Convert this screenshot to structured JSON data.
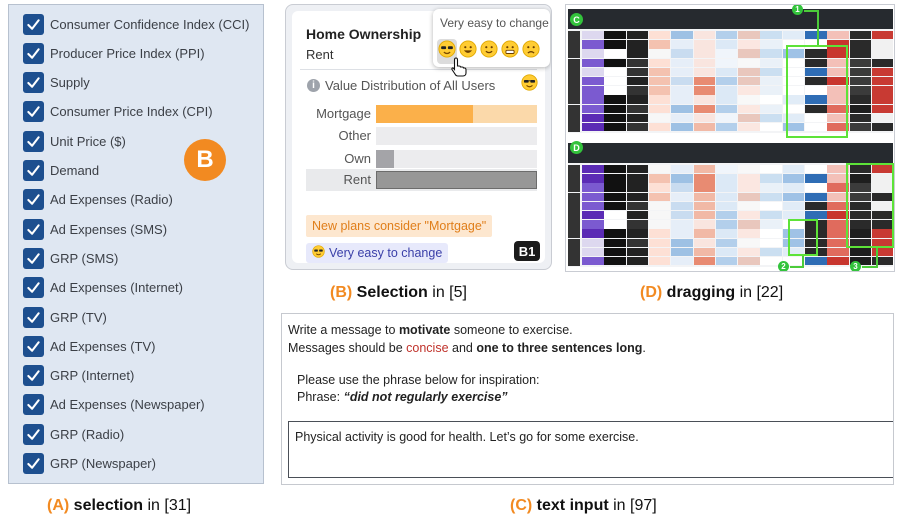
{
  "panel_a": {
    "badge": "B",
    "items": [
      {
        "label": "Consumer Confidence Index (CCI)",
        "checked": true
      },
      {
        "label": "Producer Price Index (PPI)",
        "checked": true
      },
      {
        "label": "Supply",
        "checked": true
      },
      {
        "label": "Consumer Price Index (CPI)",
        "checked": true
      },
      {
        "label": "Unit Price ($)",
        "checked": true
      },
      {
        "label": "Demand",
        "checked": true
      },
      {
        "label": "Ad Expenses (Radio)",
        "checked": true
      },
      {
        "label": "Ad Expenses (SMS)",
        "checked": true
      },
      {
        "label": "GRP (SMS)",
        "checked": true
      },
      {
        "label": "Ad Expenses (Internet)",
        "checked": true
      },
      {
        "label": "GRP (TV)",
        "checked": true
      },
      {
        "label": "Ad Expenses (TV)",
        "checked": true
      },
      {
        "label": "GRP (Internet)",
        "checked": true
      },
      {
        "label": "Ad Expenses (Newspaper)",
        "checked": true
      },
      {
        "label": "GRP (Radio)",
        "checked": true
      },
      {
        "label": "GRP (Newspaper)",
        "checked": true
      }
    ],
    "caption": {
      "tag": "(A)",
      "title": "selection",
      "ref": "in [31]"
    }
  },
  "panel_b": {
    "title": "Home Ownership",
    "value": "Rent",
    "popup_title": "Very easy to change",
    "distribution_title": "Value Distribution of All Users",
    "info_icon": "i",
    "bars": [
      {
        "label": "Mortgage",
        "share": 0.6,
        "color": "#fbb04a",
        "bg": "#fbd9aa"
      },
      {
        "label": "Other",
        "share": 0.0,
        "color": "#cfcfd3",
        "bg": "#ececee"
      },
      {
        "label": "Own",
        "share": 0.11,
        "color": "#a4a4a8",
        "bg": "#ececee"
      },
      {
        "label": "Rent",
        "share": 1.0,
        "color": "#979797",
        "bg": "#979797"
      }
    ],
    "suggestion": "New plans consider \"Mortgage\"",
    "chip_label": "Very easy to change",
    "badge": "B1",
    "emoji_names": [
      "cool-face-icon",
      "grin-face-icon",
      "smile-face-icon",
      "grimace-face-icon",
      "frown-face-icon"
    ],
    "caption": {
      "tag": "(B)",
      "title": "Selection",
      "ref": "in [5]"
    }
  },
  "panel_c": {
    "line1_prefix": "Write a message to",
    "line1_bold": "motivate",
    "line1_suffix": "someone to exercise.",
    "line2_prefix": "Messages should be",
    "line2_red": "concise",
    "line2_mid": "and",
    "line2_bold": "one to three sentences long",
    "line2_suffix": ".",
    "line3": "Please use the phrase below for inspiration:",
    "line4_prefix": "Phrase:",
    "line4_phrase": "“did not regularly exercise”",
    "input_value": "Physical activity is good for health. Let’s go for some exercise.",
    "caption": {
      "tag": "(C)",
      "title": "text input",
      "ref": "in [97]"
    }
  },
  "panel_d": {
    "badge_top": "C",
    "badge_bottom": "D",
    "callouts": [
      "1",
      "2",
      "3"
    ],
    "caption": {
      "tag": "(D)",
      "title": "dragging",
      "ref": "in [22]"
    }
  }
}
